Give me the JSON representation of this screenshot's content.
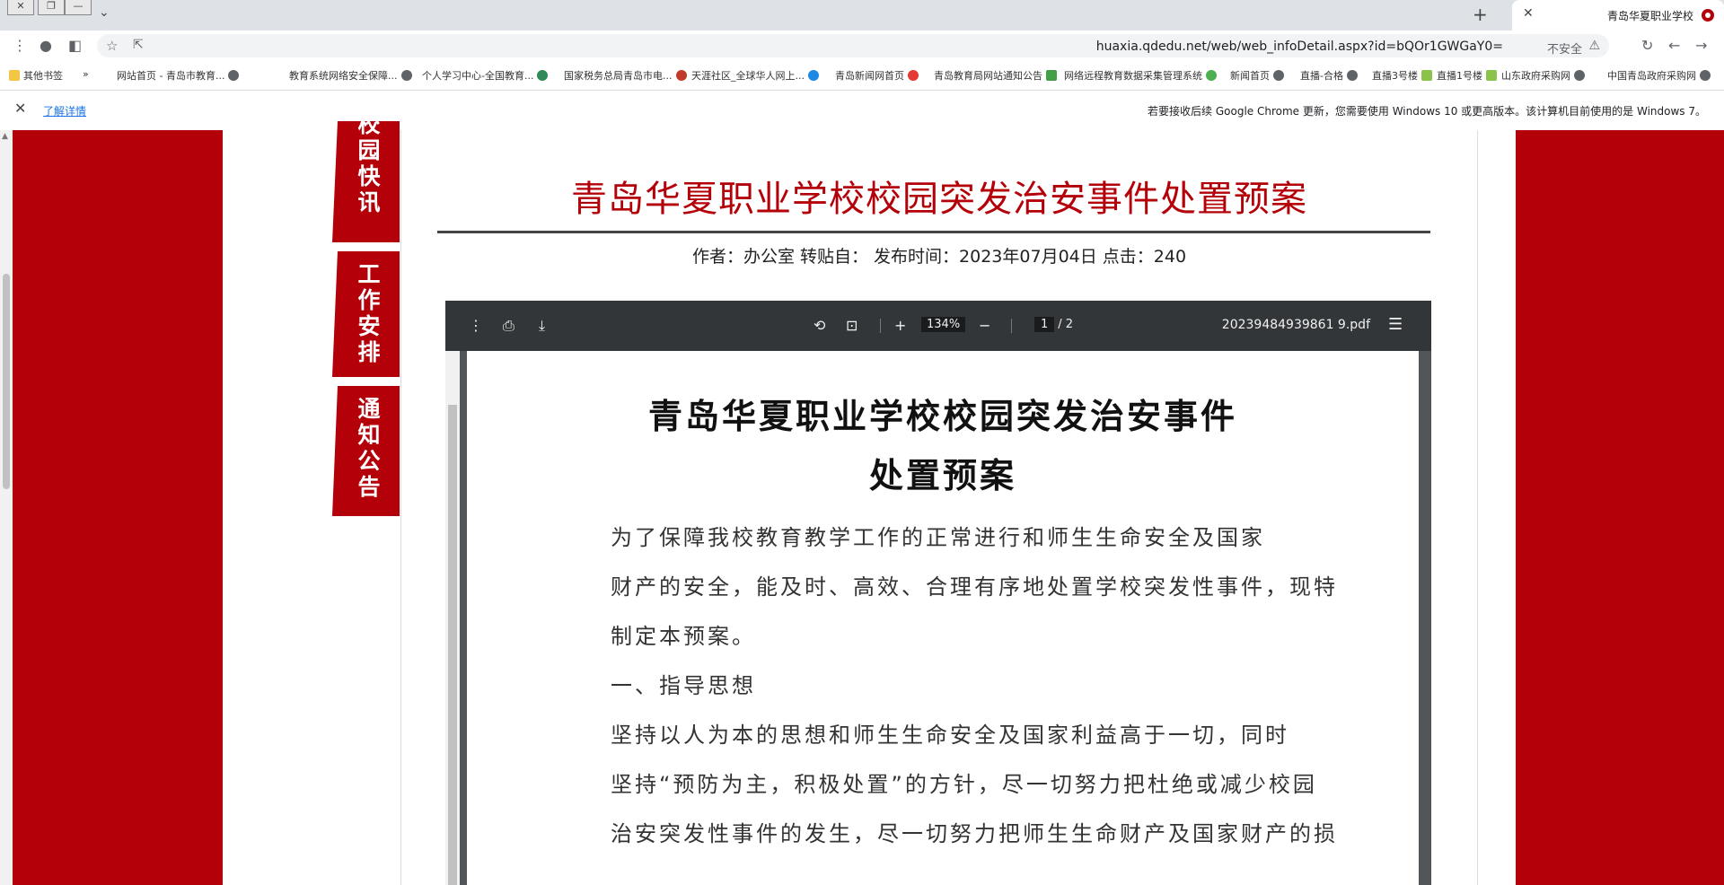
{
  "browser": {
    "tab_title": "青岛华夏职业学校",
    "url": "huaxia.qdedu.net/web/web_infoDetail.aspx?id=bQOr1GWGaY0=",
    "security_label": "不安全",
    "bookmarks": [
      "中国青岛政府采购网",
      "山东政府采购网",
      "直播1号楼",
      "直播3号楼",
      "直播-合格",
      "新闻首页",
      "网络远程教育数据采集管理系统",
      "青岛教育局网站通知公告",
      "青岛新闻网首页",
      "天涯社区_全球华人网上...",
      "国家税务总局青岛市电...",
      "个人学习中心-全国教育...",
      "教育系统网络安全保障...",
      "网站首页 - 青岛市教育...",
      "»",
      "其他书签"
    ],
    "infobar_text": "若要接收后续 Google Chrome 更新，您需要使用 Windows 10 或更高版本。该计算机目前使用的是 Windows 7。",
    "infobar_link": "了解详情"
  },
  "sidebar": {
    "tabs": [
      "校园快讯",
      "工作安排",
      "通知公告"
    ]
  },
  "article": {
    "title": "青岛华夏职业学校校园突发治安事件处置预案",
    "meta": "作者：办公室    转贴自：    发布时间：2023年07月04日    点击：240"
  },
  "pdf": {
    "filename": "20239484939861 9.pdf",
    "page_current": "1",
    "page_total": "/ 2",
    "zoom": "134%",
    "title_line1": "青岛华夏职业学校校园突发治安事件",
    "title_line2": "处置预案",
    "paragraphs": [
      "为了保障我校教育教学工作的正常进行和师生生命安全及国家",
      "财产的安全，能及时、高效、合理有序地处置学校突发性事件，现特",
      "制定本预案。",
      "一、指导思想",
      "坚持以人为本的思想和师生生命安全及国家利益高于一切，同时",
      "坚持“预防为主，积极处置”的方针，尽一切努力把杜绝或减少校园",
      "治安突发性事件的发生，尽一切努力把师生生命财产及国家财产的损"
    ]
  }
}
